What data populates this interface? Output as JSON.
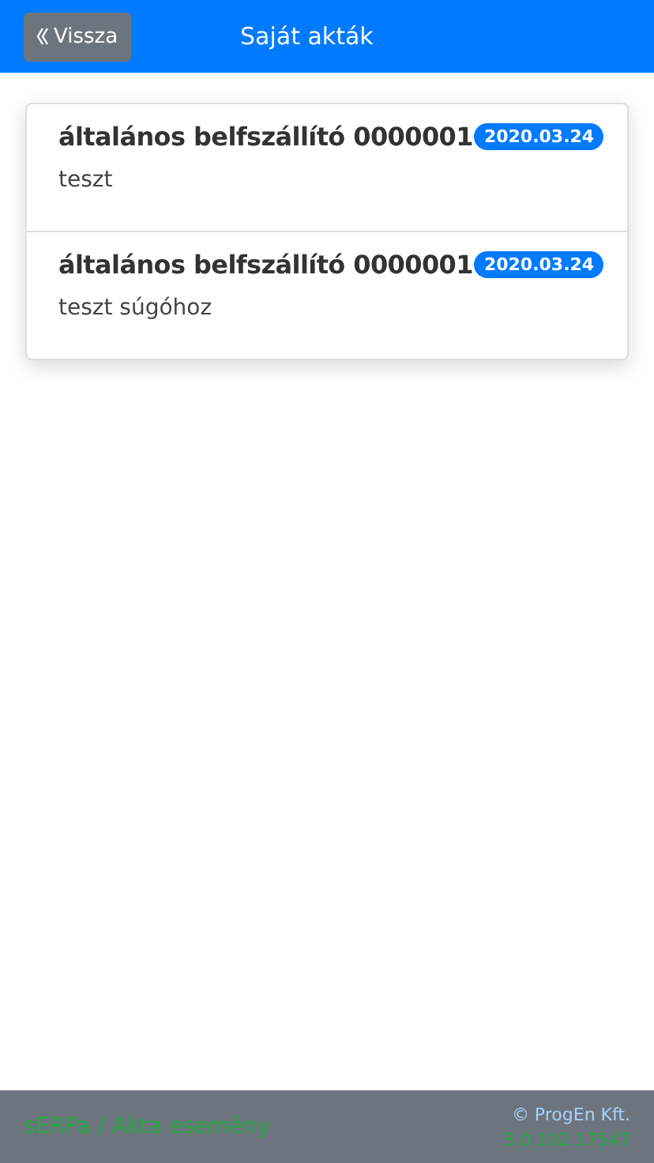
{
  "header": {
    "back_button": "Vissza",
    "title": "Saját akták"
  },
  "items": [
    {
      "title": "általános belfszállító 0000001",
      "date": "2020.03.24",
      "description": "teszt"
    },
    {
      "title": "általános belfszállító 0000001",
      "date": "2020.03.24",
      "description": "teszt súgóhoz"
    }
  ],
  "footer": {
    "breadcrumb": "sERPa / Akta esemény",
    "copyright": "© ProgEn Kft.",
    "version": "3.0.102.17547"
  }
}
